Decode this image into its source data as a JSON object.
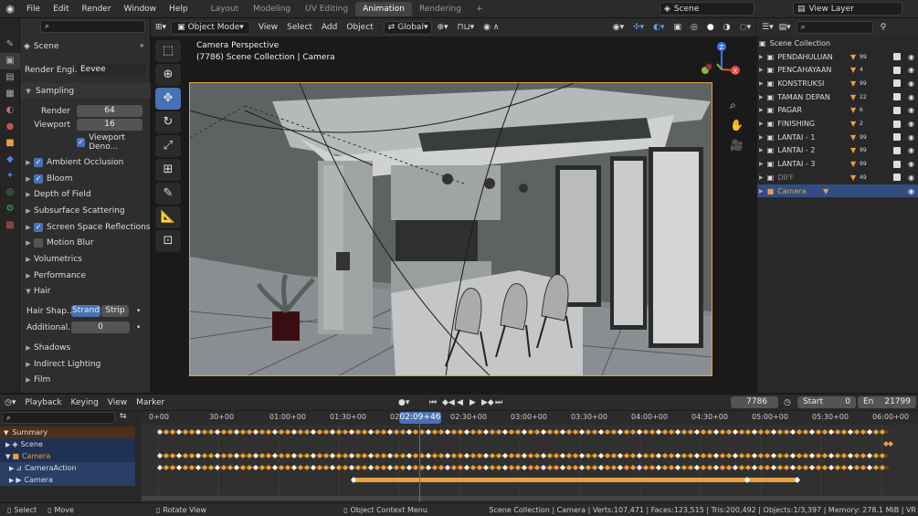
{
  "topbar": {
    "menus": [
      "File",
      "Edit",
      "Render",
      "Window",
      "Help"
    ],
    "workspaces": [
      "Layout",
      "Modeling",
      "UV Editing",
      "Animation",
      "Rendering"
    ],
    "active_workspace": "Animation",
    "scene": "Scene",
    "view_layer": "View Layer"
  },
  "props": {
    "title": "Scene",
    "render_engine_label": "Render Engi...",
    "render_engine": "Eevee",
    "sampling": "Sampling",
    "render_label": "Render",
    "render_val": "64",
    "viewport_label": "Viewport",
    "viewport_val": "16",
    "viewport_denoise": "Viewport Deno...",
    "ao": "Ambient Occlusion",
    "bloom": "Bloom",
    "dof": "Depth of Field",
    "sss": "Subsurface Scattering",
    "ssr": "Screen Space Reflections",
    "motion_blur": "Motion Blur",
    "volumetrics": "Volumetrics",
    "performance": "Performance",
    "hair": "Hair",
    "hair_shape": "Hair Shap...",
    "strand": "Strand",
    "strip": "Strip",
    "additional": "Additional...",
    "additional_val": "0",
    "shadows": "Shadows",
    "indirect": "Indirect Lighting",
    "film": "Film"
  },
  "viewport": {
    "mode": "Object Mode",
    "menus": [
      "View",
      "Select",
      "Add",
      "Object"
    ],
    "orientation": "Global",
    "overlay_title": "Camera Perspective",
    "overlay_sub": "(7786) Scene Collection | Camera"
  },
  "outliner": {
    "title": "Scene Collection",
    "rows": [
      {
        "name": "PENDAHULUAN",
        "badge": "99"
      },
      {
        "name": "PENCAHAYAAN",
        "badge": "4"
      },
      {
        "name": "KONSTRUKSI",
        "badge": "99"
      },
      {
        "name": "TAMAN DEPAN",
        "badge": "22"
      },
      {
        "name": "PAGAR",
        "badge": "6"
      },
      {
        "name": "FINISHING",
        "badge": "2"
      },
      {
        "name": "LANTAI - 1",
        "badge": "99"
      },
      {
        "name": "LANTAI - 2",
        "badge": "99"
      },
      {
        "name": "LANTAI - 3",
        "badge": "99"
      },
      {
        "name": "DIFF",
        "badge": "49"
      },
      {
        "name": "Camera",
        "badge": ""
      }
    ]
  },
  "timeline": {
    "menus": [
      "Playback",
      "Keying",
      "View",
      "Marker"
    ],
    "frame": "7786",
    "start_label": "Start",
    "start": "0",
    "end_label": "En",
    "end": "21799",
    "current": "02:09+46",
    "ticks": [
      "0+00",
      "30+00",
      "01:00+00",
      "01:30+00",
      "02:00+00",
      "02:30+00",
      "03:00+00",
      "03:30+00",
      "04:00+00",
      "04:30+00",
      "05:00+00",
      "05:30+00",
      "06:00+00"
    ],
    "channels": [
      "Summary",
      "Scene",
      "Camera",
      "CameraAction",
      "Camera"
    ]
  },
  "status": {
    "select": "Select",
    "move": "Move",
    "rotate": "Rotate View",
    "context": "Object Context Menu",
    "stats": "Scene Collection | Camera | Verts:107,471 | Faces:123,515 | Tris:200,492 | Objects:1/3,397 | Memory: 278.1 MiB | VR"
  },
  "colors": {
    "accent": "#4772b3",
    "key": "#e8a040",
    "playhead": "#4772b3"
  }
}
